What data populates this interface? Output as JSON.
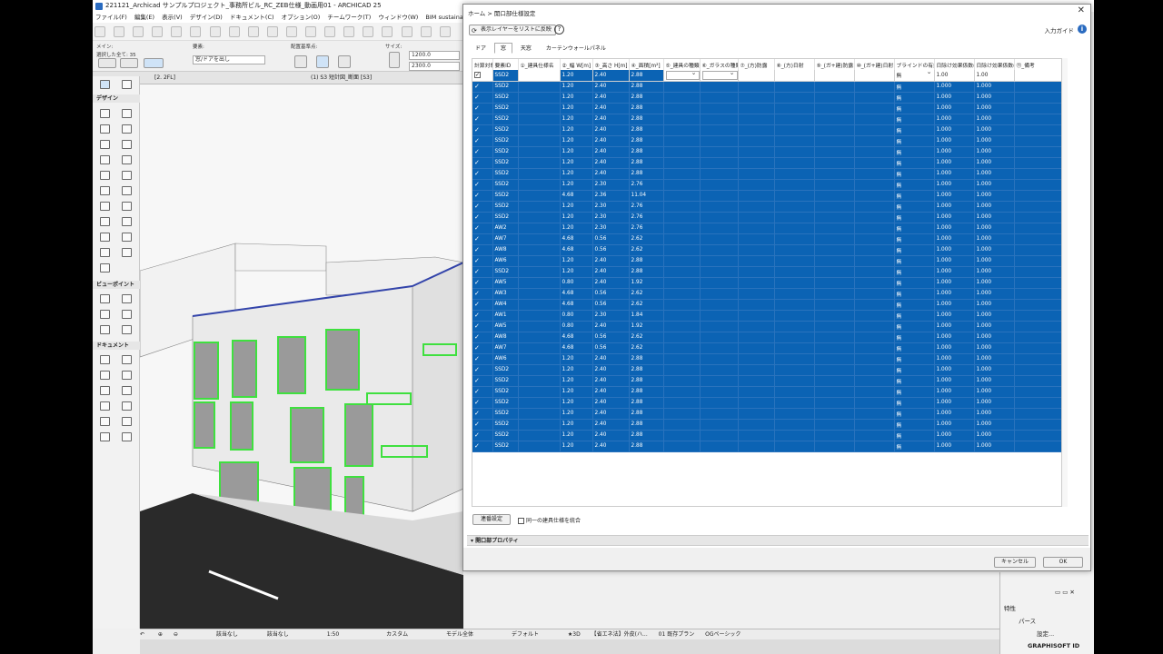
{
  "window": {
    "title": "221121_Archicad サンプルプロジェクト_事務所ビル_RC_ZEB仕様_動画用01 - ARCHICAD 25"
  },
  "menu": [
    "ファイル(F)",
    "編集(E)",
    "表示(V)",
    "デザイン(D)",
    "ドキュメント(C)",
    "オプション(O)",
    "チームワーク(T)",
    "ウィンドウ(W)",
    "BIM sustaina for Energy Sync"
  ],
  "infobox": {
    "main_label": "メイン:",
    "selection_label": "選択した全て: 35",
    "element_label": "要素:",
    "element_value": "窓/ドアを出し",
    "anchor_label": "配置基準点:",
    "size_label": "サイズ:",
    "width": "1200.0",
    "height": "2300.0"
  },
  "tabs": {
    "story": "[2. 2FL]",
    "section": "(1) S3 短計図_断面 [S3]"
  },
  "toolbox": {
    "design": "デザイン",
    "viewpoint": "ビューポイント",
    "document": "ドキュメント"
  },
  "dialog": {
    "breadcrumb": "ホーム > 開口部仕様設定",
    "reflect_button": "表示レイヤーをリストに反映",
    "help": "?",
    "guide": "入力ガイド",
    "info": "i",
    "tabs": [
      "ドア",
      "窓",
      "天窓",
      "カーテンウォールパネル"
    ],
    "columns": [
      "計算対象",
      "要素ID",
      "①_建具仕様名",
      "②_幅 W[m]",
      "③_高さ H[m]",
      "④_面積[m²]",
      "⑤_建具の種類",
      "⑥_ガラスの種類",
      "⑦_(方)防露",
      "⑧_(方)日射",
      "⑨_(ガ+建)防露",
      "⑩_(ガ+建)日射",
      "ブラインドの有無",
      "日除け効果係数(冷)",
      "日除け効果係数(暖)",
      "⑪_備考"
    ],
    "first_row": {
      "id": "SSD2",
      "w": "1.20",
      "h": "2.40",
      "area": "2.88",
      "blind": "無",
      "cool": "1.00",
      "heat": "1.00"
    },
    "rows": [
      {
        "check": "✓",
        "id": "SSD2",
        "w": "1.20",
        "h": "2.40",
        "area": "2.88",
        "blind": "無",
        "cool": "1.000",
        "heat": "1.000"
      },
      {
        "check": "✓",
        "id": "SSD2",
        "w": "1.20",
        "h": "2.40",
        "area": "2.88",
        "blind": "無",
        "cool": "1.000",
        "heat": "1.000"
      },
      {
        "check": "✓",
        "id": "SSD2",
        "w": "1.20",
        "h": "2.40",
        "area": "2.88",
        "blind": "無",
        "cool": "1.000",
        "heat": "1.000"
      },
      {
        "check": "✓",
        "id": "SSD2",
        "w": "1.20",
        "h": "2.40",
        "area": "2.88",
        "blind": "無",
        "cool": "1.000",
        "heat": "1.000"
      },
      {
        "check": "✓",
        "id": "SSD2",
        "w": "1.20",
        "h": "2.40",
        "area": "2.88",
        "blind": "無",
        "cool": "1.000",
        "heat": "1.000"
      },
      {
        "check": "✓",
        "id": "SSD2",
        "w": "1.20",
        "h": "2.40",
        "area": "2.88",
        "blind": "無",
        "cool": "1.000",
        "heat": "1.000"
      },
      {
        "check": "✓",
        "id": "SSD2",
        "w": "1.20",
        "h": "2.40",
        "area": "2.88",
        "blind": "無",
        "cool": "1.000",
        "heat": "1.000"
      },
      {
        "check": "✓",
        "id": "SSD2",
        "w": "1.20",
        "h": "2.40",
        "area": "2.88",
        "blind": "無",
        "cool": "1.000",
        "heat": "1.000"
      },
      {
        "check": "✓",
        "id": "SSD2",
        "w": "1.20",
        "h": "2.40",
        "area": "2.88",
        "blind": "無",
        "cool": "1.000",
        "heat": "1.000"
      },
      {
        "check": "✓",
        "id": "SSD2",
        "w": "1.20",
        "h": "2.30",
        "area": "2.76",
        "blind": "無",
        "cool": "1.000",
        "heat": "1.000"
      },
      {
        "check": "✓",
        "id": "SSD2",
        "w": "4.68",
        "h": "2.36",
        "area": "11.04",
        "blind": "無",
        "cool": "1.000",
        "heat": "1.000"
      },
      {
        "check": "✓",
        "id": "SSD2",
        "w": "1.20",
        "h": "2.30",
        "area": "2.76",
        "blind": "無",
        "cool": "1.000",
        "heat": "1.000"
      },
      {
        "check": "✓",
        "id": "SSD2",
        "w": "1.20",
        "h": "2.30",
        "area": "2.76",
        "blind": "無",
        "cool": "1.000",
        "heat": "1.000"
      },
      {
        "check": "✓",
        "id": "AW2",
        "w": "1.20",
        "h": "2.30",
        "area": "2.76",
        "blind": "無",
        "cool": "1.000",
        "heat": "1.000"
      },
      {
        "check": "✓",
        "id": "AW7",
        "w": "4.68",
        "h": "0.56",
        "area": "2.62",
        "blind": "無",
        "cool": "1.000",
        "heat": "1.000"
      },
      {
        "check": "✓",
        "id": "AW8",
        "w": "4.68",
        "h": "0.56",
        "area": "2.62",
        "blind": "無",
        "cool": "1.000",
        "heat": "1.000"
      },
      {
        "check": "✓",
        "id": "AW6",
        "w": "1.20",
        "h": "2.40",
        "area": "2.88",
        "blind": "無",
        "cool": "1.000",
        "heat": "1.000"
      },
      {
        "check": "✓",
        "id": "SSD2",
        "w": "1.20",
        "h": "2.40",
        "area": "2.88",
        "blind": "無",
        "cool": "1.000",
        "heat": "1.000"
      },
      {
        "check": "✓",
        "id": "AW5",
        "w": "0.80",
        "h": "2.40",
        "area": "1.92",
        "blind": "無",
        "cool": "1.000",
        "heat": "1.000"
      },
      {
        "check": "✓",
        "id": "AW3",
        "w": "4.68",
        "h": "0.56",
        "area": "2.62",
        "blind": "無",
        "cool": "1.000",
        "heat": "1.000"
      },
      {
        "check": "✓",
        "id": "AW4",
        "w": "4.68",
        "h": "0.56",
        "area": "2.62",
        "blind": "無",
        "cool": "1.000",
        "heat": "1.000"
      },
      {
        "check": "✓",
        "id": "AW1",
        "w": "0.80",
        "h": "2.30",
        "area": "1.84",
        "blind": "無",
        "cool": "1.000",
        "heat": "1.000"
      },
      {
        "check": "✓",
        "id": "AW5",
        "w": "0.80",
        "h": "2.40",
        "area": "1.92",
        "blind": "無",
        "cool": "1.000",
        "heat": "1.000"
      },
      {
        "check": "✓",
        "id": "AW8",
        "w": "4.68",
        "h": "0.56",
        "area": "2.62",
        "blind": "無",
        "cool": "1.000",
        "heat": "1.000"
      },
      {
        "check": "✓",
        "id": "AW7",
        "w": "4.68",
        "h": "0.56",
        "area": "2.62",
        "blind": "無",
        "cool": "1.000",
        "heat": "1.000"
      },
      {
        "check": "✓",
        "id": "AW6",
        "w": "1.20",
        "h": "2.40",
        "area": "2.88",
        "blind": "無",
        "cool": "1.000",
        "heat": "1.000"
      },
      {
        "check": "✓",
        "id": "SSD2",
        "w": "1.20",
        "h": "2.40",
        "area": "2.88",
        "blind": "無",
        "cool": "1.000",
        "heat": "1.000"
      },
      {
        "check": "✓",
        "id": "SSD2",
        "w": "1.20",
        "h": "2.40",
        "area": "2.88",
        "blind": "無",
        "cool": "1.000",
        "heat": "1.000"
      },
      {
        "check": "✓",
        "id": "SSD2",
        "w": "1.20",
        "h": "2.40",
        "area": "2.88",
        "blind": "無",
        "cool": "1.000",
        "heat": "1.000"
      },
      {
        "check": "✓",
        "id": "SSD2",
        "w": "1.20",
        "h": "2.40",
        "area": "2.88",
        "blind": "無",
        "cool": "1.000",
        "heat": "1.000"
      },
      {
        "check": "✓",
        "id": "SSD2",
        "w": "1.20",
        "h": "2.40",
        "area": "2.88",
        "blind": "無",
        "cool": "1.000",
        "heat": "1.000"
      },
      {
        "check": "✓",
        "id": "SSD2",
        "w": "1.20",
        "h": "2.40",
        "area": "2.88",
        "blind": "無",
        "cool": "1.000",
        "heat": "1.000"
      },
      {
        "check": "✓",
        "id": "SSD2",
        "w": "1.20",
        "h": "2.40",
        "area": "2.88",
        "blind": "無",
        "cool": "1.000",
        "heat": "1.000"
      },
      {
        "check": "✓",
        "id": "SSD2",
        "w": "1.20",
        "h": "2.40",
        "area": "2.88",
        "blind": "無",
        "cool": "1.000",
        "heat": "1.000"
      }
    ],
    "sort_button": "連番設定",
    "merge_label": "同一の建具仕様を統合",
    "properties_header": "開口部プロパティ",
    "cancel": "キャンセル",
    "ok": "OK"
  },
  "status_bar": [
    "該当なし",
    "該当なし",
    "1:50",
    "カスタム",
    "モデル全体",
    "デフォルト",
    "★3D",
    "【省エネ法】外皮(ハ...",
    "01 既存プラン",
    "OGペーシック"
  ],
  "right_panel": {
    "header": "特性",
    "item": "パース",
    "settings": "設定...",
    "brand": "GRAPHISOFT ID"
  },
  "colors": {
    "selection": "#0b63b4",
    "window_frame": "#3fe03f",
    "accent": "#2a6bc0"
  }
}
